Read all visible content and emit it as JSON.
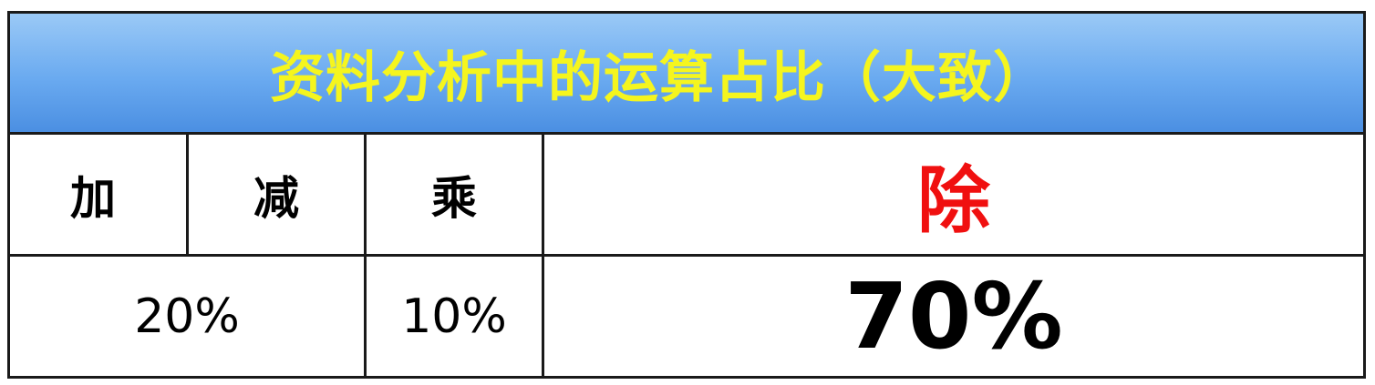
{
  "header": {
    "title": "资料分析中的运算占比（大致）"
  },
  "operations": {
    "add": "加",
    "subtract": "减",
    "multiply": "乘",
    "divide": "除"
  },
  "shares": {
    "add_subtract": "20%",
    "multiply": "10%",
    "divide": "70%"
  },
  "colors": {
    "header_bg": "#6aaaf0",
    "title_text": "#f5f51e",
    "divide_text": "#f01010"
  }
}
